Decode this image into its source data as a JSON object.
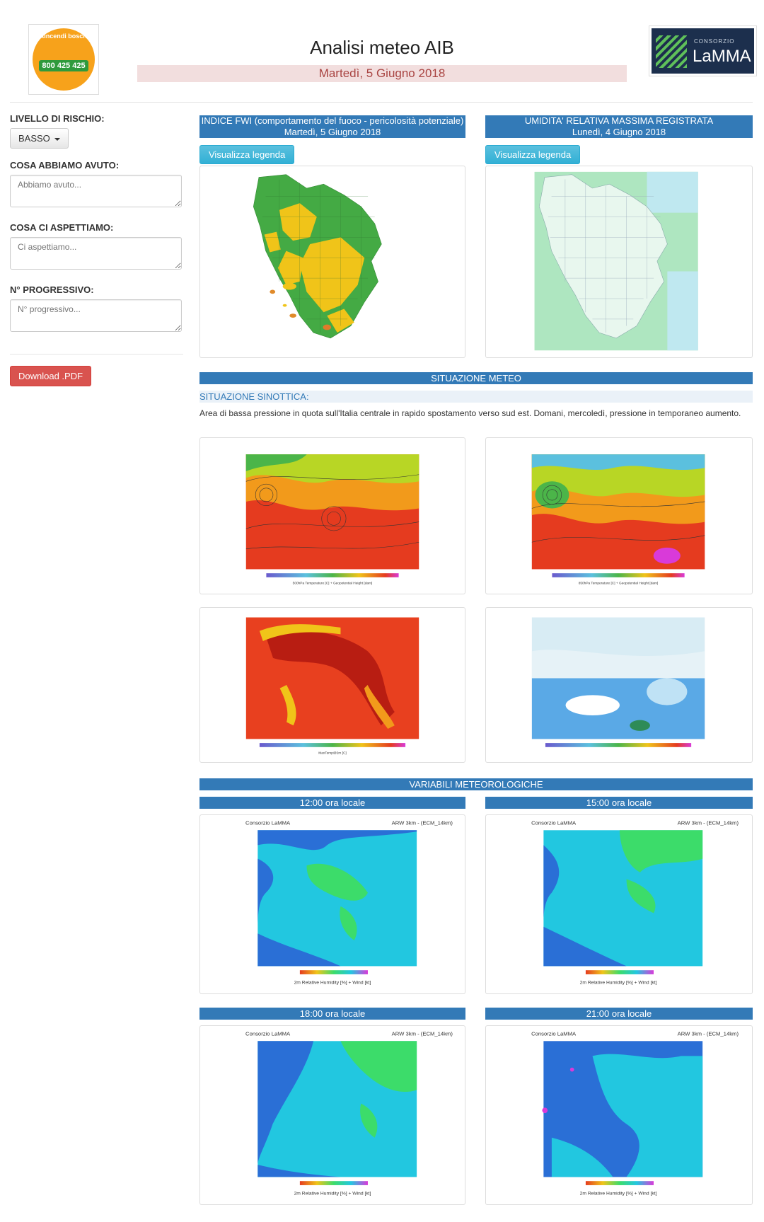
{
  "header": {
    "title": "Analisi meteo AIB",
    "date": "Martedì, 5 Giugno 2018",
    "left_logo": {
      "ring_text": "Antincendi boschivi",
      "phone": "800 425 425"
    },
    "right_logo": {
      "small": "CONSORZIO",
      "name": "LaMMA"
    }
  },
  "sidebar": {
    "risk_label": "LIVELLO DI RISCHIO:",
    "risk_value": "BASSO",
    "had_label": "COSA ABBIAMO AVUTO:",
    "had_placeholder": "Abbiamo avuto...",
    "expect_label": "COSA CI ASPETTIAMO:",
    "expect_placeholder": "Ci aspettiamo...",
    "prog_label": "N° PROGRESSIVO:",
    "prog_placeholder": "N° progressivo...",
    "download_label": "Download .PDF"
  },
  "fwi": {
    "title_line1": "INDICE FWI (comportamento del fuoco - pericolosità potenziale)",
    "title_line2": "Martedì, 5 Giugno 2018",
    "legend_button": "Visualizza legenda"
  },
  "humidity": {
    "title_line1": "UMIDITA' RELATIVA MASSIMA REGISTRATA",
    "title_line2": "Lunedì, 4 Giugno 2018",
    "legend_button": "Visualizza legenda"
  },
  "meteo": {
    "section_title": "SITUAZIONE METEO",
    "subtitle": "SITUAZIONE SINOTTICA:",
    "text": "Area di bassa pressione in quota sull'Italia centrale in rapido spostamento verso sud est. Domani, mercoledì, pressione in temporaneo aumento.",
    "maps": [
      {
        "legend": "500hPa Temperature [C] + Geopotential Height [dam]"
      },
      {
        "legend": "850hPa Temperature [C] + Geopotential Height [dam]"
      },
      {
        "legend": "MaxTemp@2m [C]"
      },
      {
        "legend": ""
      }
    ]
  },
  "variables": {
    "section_title": "VARIABILI METEOROLOGICHE",
    "times": [
      "12:00 ora locale",
      "15:00 ora locale",
      "18:00 ora locale",
      "21:00 ora locale"
    ],
    "chart_header": "Consorzio LaMMA",
    "chart_model": "ARW 3km - (ECM_14km)",
    "chart_legend": "2m Relative Humidity [%] + Wind [kt]"
  },
  "colors": {
    "primary": "#337ab7",
    "info": "#5bc0de",
    "danger": "#d9534f",
    "date_bg": "#f2dede",
    "date_text": "#a94442"
  }
}
